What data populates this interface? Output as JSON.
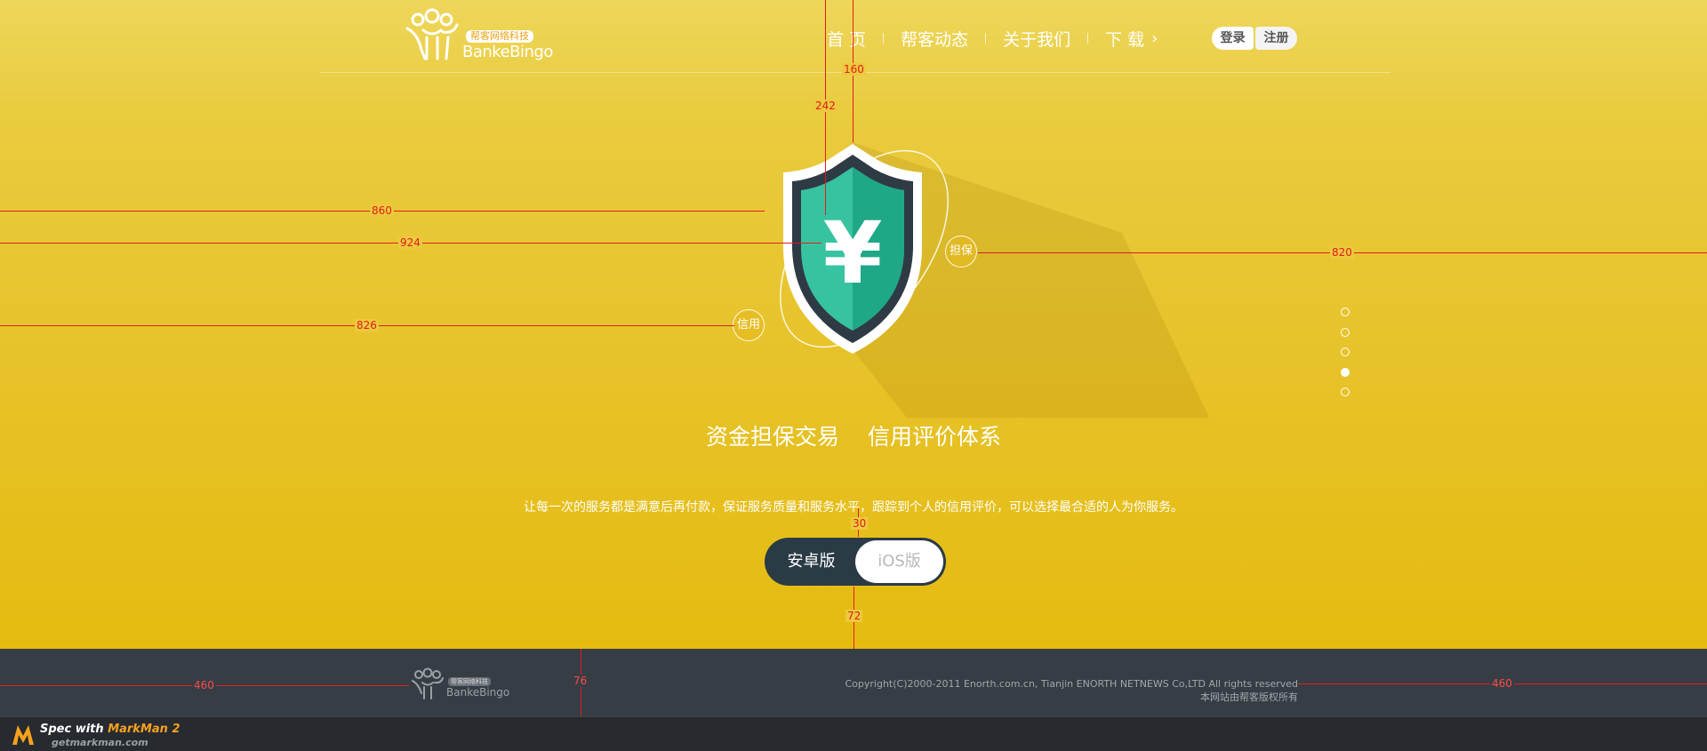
{
  "header": {
    "logo": {
      "cn": "帮客网络科技",
      "en": "BankeBingo"
    },
    "nav": [
      {
        "label": "首  页"
      },
      {
        "label": "帮客动态"
      },
      {
        "label": "关于我们"
      },
      {
        "label": "下  载"
      }
    ],
    "auth": {
      "login": "登录",
      "register": "注册"
    }
  },
  "hero": {
    "badges": {
      "guarantee": "担保",
      "credit": "信用"
    },
    "shield_symbol": "¥",
    "headline": "资金担保交易  信用评价体系",
    "subline": "让每一次的服务都是满意后再付款，保证服务质量和服务水平，跟踪到个人的信用评价，可以选择最合适的人为你服务。",
    "slides": {
      "count": 5,
      "active": 4
    },
    "download": {
      "android": "安卓版",
      "ios": "iOS版"
    }
  },
  "footer": {
    "logo": {
      "cn": "帮客网络科技",
      "en": "BankeBingo"
    },
    "copyright": "Copyright(C)2000-2011 Enorth.com.cn, Tianjin ENORTH NETNEWS Co,LTD All rights reserved",
    "rights": "本网站由帮客版权所有"
  },
  "spec_overlay": {
    "measurements": [
      "860",
      "924",
      "826",
      "820",
      "242",
      "160",
      "30",
      "72",
      "460",
      "76",
      "460"
    ]
  },
  "markman": {
    "prefix": "Spec with ",
    "brand": "MarkMan 2",
    "url": "getmarkman.com"
  },
  "colors": {
    "brand_yellow": "#e6bc16",
    "shield_green": "#1fb38a",
    "dark": "#2a3b45",
    "footer": "#373d45",
    "measure_red": "#e21d1d"
  }
}
